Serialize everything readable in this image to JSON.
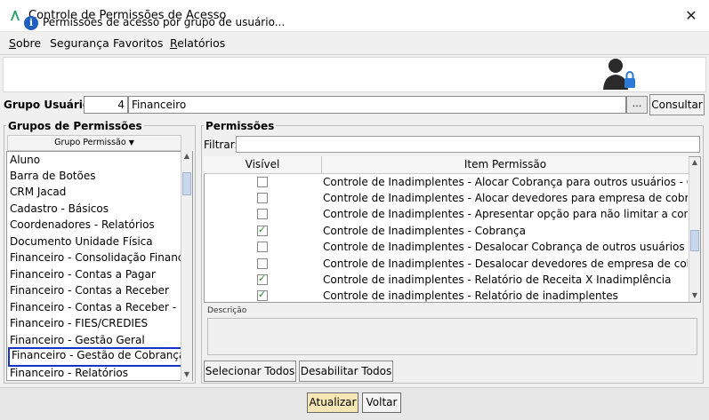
{
  "window": {
    "title": "Controle de Permissões de Acesso",
    "close_glyph": "✕"
  },
  "menu": [
    {
      "ul": "S",
      "rest": "obre"
    },
    {
      "ul": "",
      "rest": "Segurança"
    },
    {
      "ul": "",
      "rest": "Favoritos"
    },
    {
      "ul": "R",
      "rest": "elatórios"
    }
  ],
  "info": {
    "text": "Permissões de acesso por grupo de usuário...",
    "icon_glyph": "i"
  },
  "grupo_usuario": {
    "label": "Grupo Usuário:",
    "code": "4",
    "name": "Financeiro",
    "ellipsis": "...",
    "consultar": "Consultar"
  },
  "grupos": {
    "title": "Grupos de Permissões",
    "column_header": "Grupo Permissão",
    "sort_glyph": "▼",
    "items": [
      "Aluno",
      "Barra de Botões",
      "CRM Jacad",
      "Cadastro - Básicos",
      "Coordenadores - Relatórios",
      "Documento Unidade Física",
      "Financeiro - Consolidação Financ...",
      "Financeiro - Contas a Pagar",
      "Financeiro - Contas a Receber",
      "Financeiro - Contas a Receber - R...",
      "Financeiro - FIES/CREDIES",
      "Financeiro - Gestão Geral",
      "Financeiro - Gestão de Cobrança",
      "Financeiro - Relatórios"
    ],
    "selected_index": 12
  },
  "permissoes": {
    "title": "Permissões",
    "filter_label": "Filtrar:",
    "filter_value": "",
    "col_visivel": "Visível",
    "col_item": "Item Permissão",
    "rows": [
      {
        "checked": false,
        "text": "Controle de Inadimplentes - Alocar Cobrança para outros usuários - Gest..."
      },
      {
        "checked": false,
        "text": "Controle de Inadimplentes - Alocar devedores para empresa de cobrança"
      },
      {
        "checked": false,
        "text": "Controle de Inadimplentes - Apresentar opção para não limitar a consult..."
      },
      {
        "checked": true,
        "text": "Controle de Inadimplentes - Cobrança"
      },
      {
        "checked": false,
        "text": "Controle de Inadimplentes - Desalocar Cobrança de outros usuários"
      },
      {
        "checked": false,
        "text": "Controle de Inadimplentes - Desalocar devedores de empresa de cobran..."
      },
      {
        "checked": true,
        "text": "Controle de inadimplentes - Relatório de Receita X Inadimplência"
      },
      {
        "checked": true,
        "text": "Controle de inadimplentes - Relatório de inadimplentes"
      }
    ],
    "descricao_label": "Descrição",
    "descricao_value": "",
    "selecionar_todos": "Selecionar Todos",
    "desabilitar_todos": "Desabilitar Todos"
  },
  "footer": {
    "atualizar": "Atualizar",
    "voltar": "Voltar"
  },
  "colors": {
    "selection_border": "#1533c4",
    "check_green": "#2f8a2f",
    "atualizar_bg": "#f6e7b4",
    "info_blue": "#1f5fbf"
  }
}
